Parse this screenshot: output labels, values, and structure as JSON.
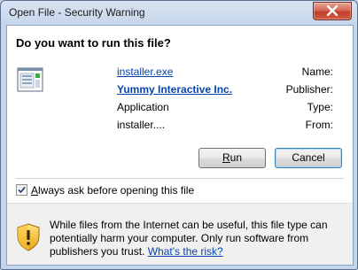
{
  "window": {
    "title": "Open File - Security Warning",
    "close_label": "Close"
  },
  "dialog": {
    "heading": "Do you want to run this file?",
    "fields": [
      {
        "label": "Name:",
        "value": "installer.exe",
        "style": "link"
      },
      {
        "label": "Publisher:",
        "value": "Yummy Interactive Inc.",
        "style": "link-bold"
      },
      {
        "label": "Type:",
        "value": "Application",
        "style": "plain"
      },
      {
        "label": "From:",
        "value": "installer....",
        "style": "plain"
      }
    ],
    "buttons": {
      "run": {
        "label": "Run",
        "accelerator": "R"
      },
      "cancel": {
        "label": "Cancel"
      }
    },
    "always_ask": {
      "checked": true,
      "label": "Always ask before opening this file",
      "accelerator": "A"
    },
    "warning": {
      "text": "While files from the Internet can be useful, this file type can potentially harm your computer. Only run software from publishers you trust.",
      "link": "What's the risk?"
    }
  },
  "icons": {
    "file": "application-file-icon",
    "shield": "security-shield-warning-icon",
    "close": "close-icon",
    "check": "checkmark-icon"
  },
  "colors": {
    "link": "#0645ad",
    "default_button_border": "#3c7fb1",
    "close_button": "#c23f2c",
    "footer_bg": "#f0f0f0"
  }
}
